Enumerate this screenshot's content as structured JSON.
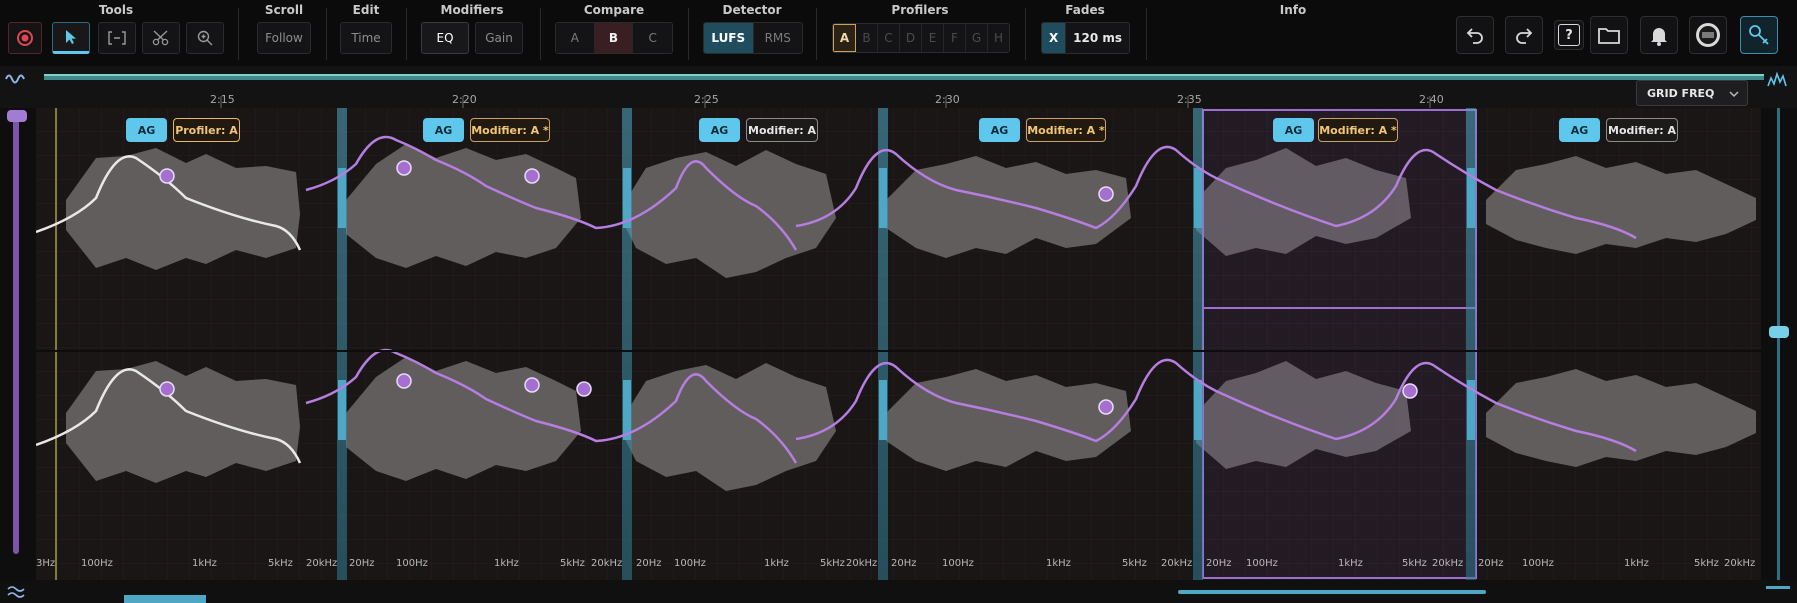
{
  "toolbar": {
    "tools_label": "Tools",
    "scroll_label": "Scroll",
    "scroll_follow": "Follow",
    "edit_label": "Edit",
    "edit_time": "Time",
    "modifiers_label": "Modifiers",
    "mod_eq": "EQ",
    "mod_gain": "Gain",
    "compare_label": "Compare",
    "compare_options": [
      "A",
      "B",
      "C"
    ],
    "compare_selected": "B",
    "detector_label": "Detector",
    "detector_lufs": "LUFS",
    "detector_rms": "RMS",
    "profilers_label": "Profilers",
    "profiler_slots": [
      "A",
      "B",
      "C",
      "D",
      "E",
      "F",
      "G",
      "H"
    ],
    "fades_label": "Fades",
    "fades_x": "X",
    "fades_value": "120 ms",
    "info_label": "Info",
    "help_icon_text": "?"
  },
  "timeline": {
    "ticks": [
      "2:15",
      "2:20",
      "2:25",
      "2:30",
      "2:35",
      "2:40"
    ],
    "view_mode": "GRID FREQ"
  },
  "segments": [
    {
      "ag": "AG",
      "tag": "Profiler: A",
      "tag_style": "prof"
    },
    {
      "ag": "AG",
      "tag": "Modifier: A *",
      "tag_style": "modo"
    },
    {
      "ag": "AG",
      "tag": "Modifier: A",
      "tag_style": "mod"
    },
    {
      "ag": "AG",
      "tag": "Modifier: A *",
      "tag_style": "modo"
    },
    {
      "ag": "AG",
      "tag": "Modifier: A *",
      "tag_style": "modo"
    },
    {
      "ag": "AG",
      "tag": "Modifier: A",
      "tag_style": "mod"
    }
  ],
  "freq_labels": [
    {
      "a": "3Hz",
      "b": "100Hz",
      "c": "1kHz",
      "d": "5kHz",
      "e": "20kHz"
    },
    {
      "a": "20Hz",
      "b": "100Hz",
      "c": "1kHz",
      "d": "5kHz",
      "e": "20kHz"
    },
    {
      "a": "20Hz",
      "b": "100Hz",
      "c": "1kHz",
      "d": "5kHz",
      "e": "20kHz"
    },
    {
      "a": "20Hz",
      "b": "100Hz",
      "c": "1kHz",
      "d": "5kHz",
      "e": "20kHz"
    },
    {
      "a": "20Hz",
      "b": "100Hz",
      "c": "1kHz",
      "d": "5kHz",
      "e": "20kHz"
    },
    {
      "a": "20Hz",
      "b": "100Hz",
      "c": "1kHz",
      "d": "5kHz",
      "e": "20kHz"
    }
  ],
  "colors": {
    "accent": "#5fc7ec",
    "curve": "#b57ee0",
    "record": "#e0474f",
    "profiler": "#e7b861"
  }
}
